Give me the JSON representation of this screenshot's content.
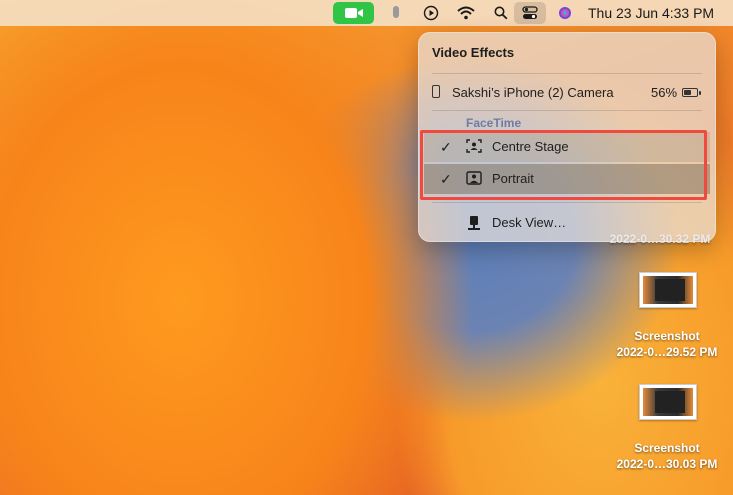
{
  "menubar": {
    "clock": "Thu 23 Jun  4:33 PM",
    "icons": [
      "facetime-video-icon",
      "microphone-icon",
      "play-circle-icon",
      "wifi-icon",
      "search-icon",
      "control-center-icon",
      "siri-icon"
    ]
  },
  "panel": {
    "title": "Video Effects",
    "camera_label": "Sakshi’s iPhone (2) Camera",
    "battery_pct": "56%",
    "battery_level": 0.56,
    "section_label": "FaceTime",
    "options": [
      {
        "label": "Centre Stage",
        "checked": true
      },
      {
        "label": "Portrait",
        "checked": true
      }
    ],
    "desk_view_label": "Desk View…"
  },
  "desktop": {
    "partial_label": "2022-0…30.32 PM",
    "icons": [
      {
        "name": "Screenshot",
        "detail": "2022-0…29.52 PM"
      },
      {
        "name": "Screenshot",
        "detail": "2022-0…30.03 PM"
      }
    ]
  },
  "colors": {
    "facetime_green": "#31c548",
    "highlight_red": "#f04a3f",
    "section_label": "#6e7da0"
  }
}
